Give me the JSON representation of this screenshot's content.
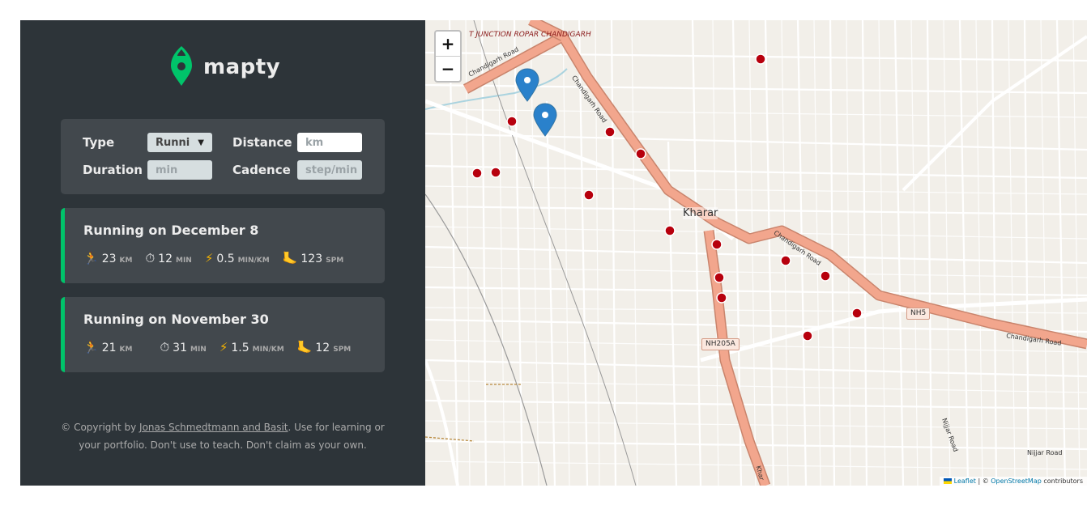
{
  "brand": {
    "name": "mapty",
    "accent": "#00c46a"
  },
  "form": {
    "type_label": "Type",
    "type_value": "Runni",
    "distance_label": "Distance",
    "distance_placeholder": "km",
    "duration_label": "Duration",
    "duration_placeholder": "min",
    "cadence_label": "Cadence",
    "cadence_placeholder": "step/min"
  },
  "workouts": [
    {
      "title": "Running on December 8",
      "distance": "23",
      "distance_unit": "km",
      "duration": "12",
      "duration_unit": "min",
      "pace": "0.5",
      "pace_unit": "min/km",
      "cadence": "123",
      "cadence_unit": "spm"
    },
    {
      "title": "Running on November 30",
      "distance": "21",
      "distance_unit": "km",
      "duration": "31",
      "duration_unit": "min",
      "pace": "1.5",
      "pace_unit": "min/km",
      "cadence": "12",
      "cadence_unit": "spm"
    }
  ],
  "copyright": {
    "prefix": "© Copyright by ",
    "link": "Jonas Schmedtmann and Basit",
    "suffix": ". Use for learning or your portfolio. Don't use to teach. Don't claim as your own."
  },
  "map": {
    "zoom_in": "+",
    "zoom_out": "−",
    "place_label": "Kharar",
    "junction_label": "T JUNCTION ROPAR CHANDIGARH",
    "road_labels": [
      "Chandigarh Road",
      "Chandigarh Road",
      "Chandigarh Road",
      "Chandigarh Road",
      "Nijjar Road",
      "Nijjar Road",
      "Khar"
    ],
    "shields": [
      "NH5",
      "NH205A"
    ],
    "attribution_leaflet": "Leaflet",
    "attribution_sep": " | © ",
    "attribution_osm": "OpenStreetMap",
    "attribution_suffix": " contributors"
  }
}
